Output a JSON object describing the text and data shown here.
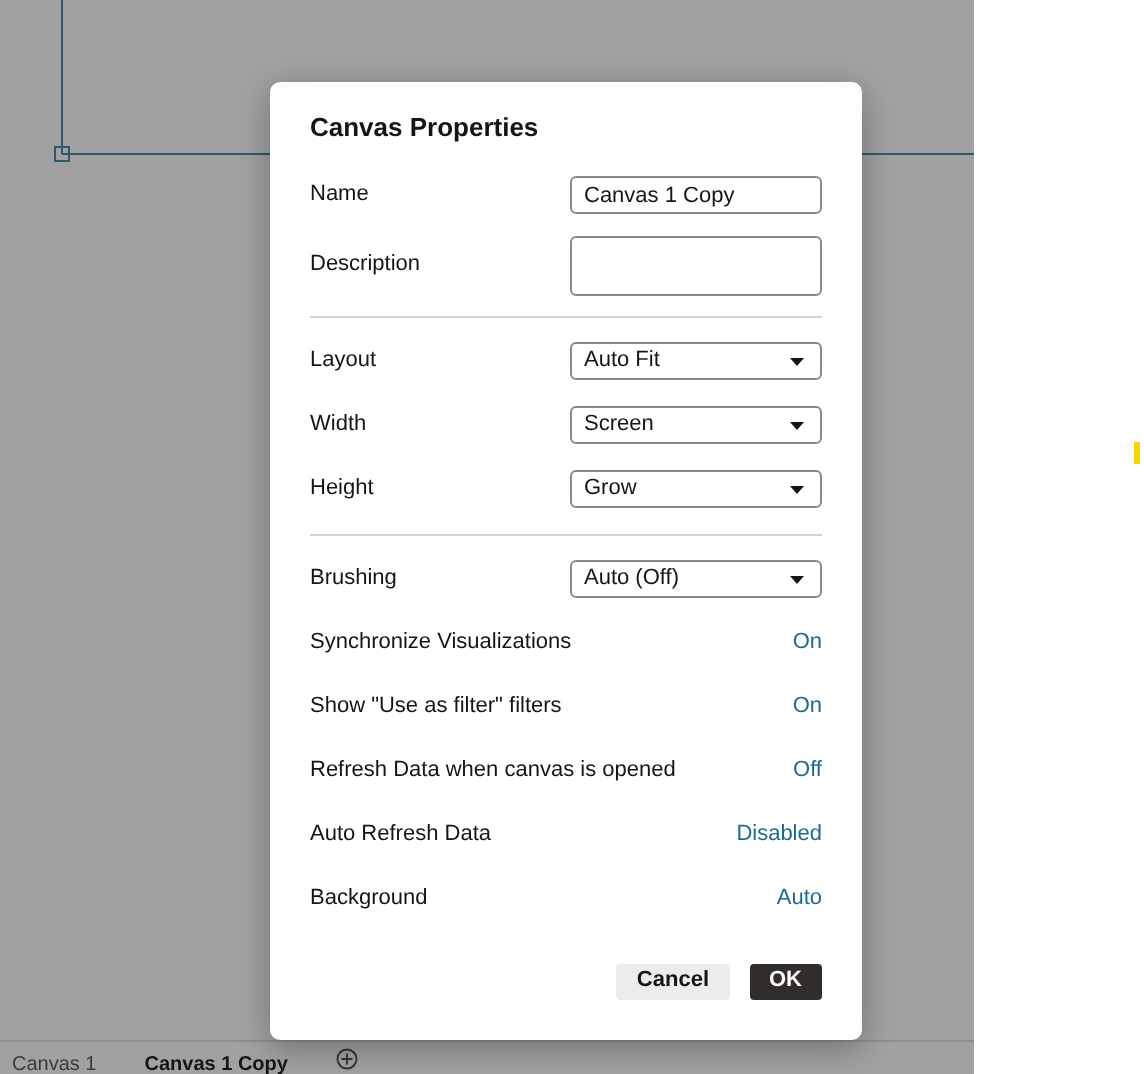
{
  "dialog": {
    "title": "Canvas Properties",
    "sections": [
      [
        {
          "kind": "text",
          "label": "Name",
          "value": "Canvas 1 Copy"
        },
        {
          "kind": "textarea",
          "label": "Description"
        }
      ],
      [
        {
          "kind": "select",
          "label": "Layout",
          "value": "Auto Fit"
        },
        {
          "kind": "select",
          "label": "Width",
          "value": "Screen"
        },
        {
          "kind": "select",
          "label": "Height",
          "value": "Grow"
        }
      ],
      [
        {
          "kind": "select",
          "label": "Brushing",
          "value": "Auto (Off)"
        },
        {
          "kind": "link",
          "label": "Synchronize Visualizations",
          "value": "On"
        },
        {
          "kind": "link",
          "label": "Show \"Use as filter\" filters",
          "value": "On"
        },
        {
          "kind": "link",
          "label": "Refresh Data when canvas is opened",
          "value": "Off"
        },
        {
          "kind": "link",
          "label": "Auto Refresh Data",
          "value": "Disabled"
        },
        {
          "kind": "link",
          "label": "Background",
          "value": "Auto"
        }
      ]
    ],
    "buttons": [
      {
        "label": "Cancel",
        "kind": "secondary"
      },
      {
        "label": "OK",
        "kind": "primary"
      }
    ]
  },
  "canvas_tabs": {
    "tabs": [
      {
        "label": "Canvas 1",
        "selected": false
      },
      {
        "label": "Canvas 1 Copy",
        "selected": true
      }
    ]
  }
}
